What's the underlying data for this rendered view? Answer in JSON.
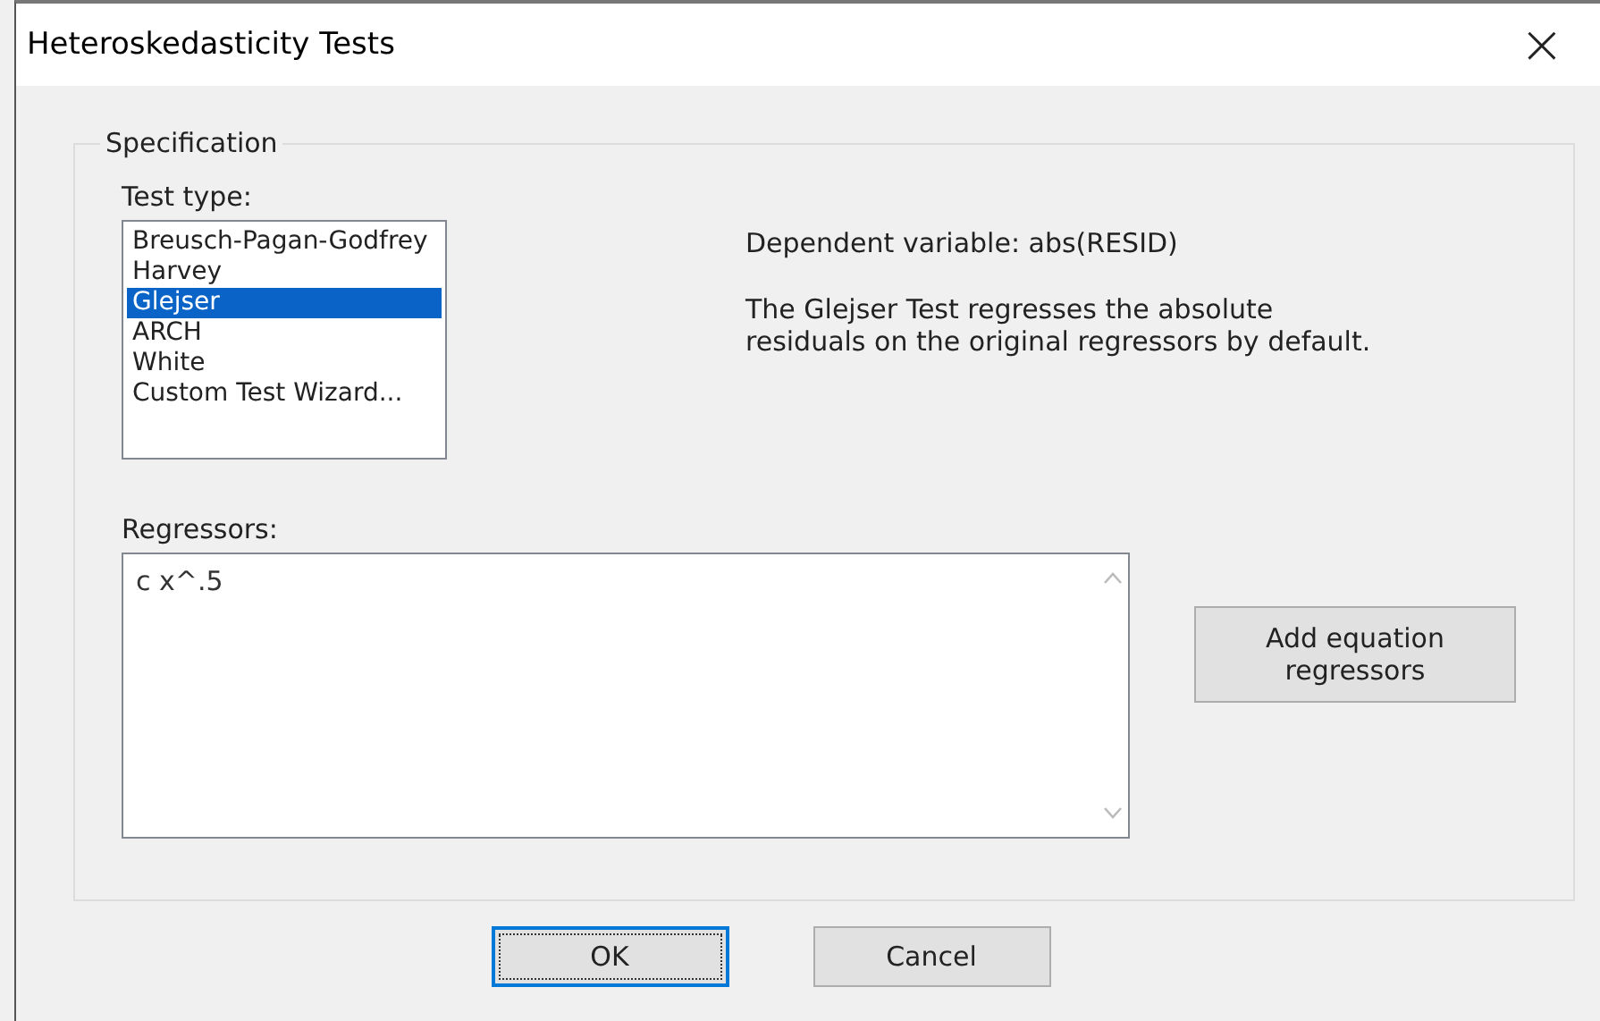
{
  "window": {
    "title": "Heteroskedasticity Tests",
    "close": "×"
  },
  "group": {
    "title": "Specification"
  },
  "test_type": {
    "label": "Test type:",
    "items": [
      {
        "label": "Breusch-Pagan-Godfrey",
        "selected": false
      },
      {
        "label": "Harvey",
        "selected": false
      },
      {
        "label": "Glejser",
        "selected": true
      },
      {
        "label": "ARCH",
        "selected": false
      },
      {
        "label": "White",
        "selected": false
      },
      {
        "label": "Custom Test Wizard...",
        "selected": false
      }
    ]
  },
  "dependent_variable": "Dependent variable: abs(RESID)",
  "description": "The Glejser Test regresses the absolute residuals on the original regressors by default.",
  "regressors": {
    "label": "Regressors:",
    "value": "c x^.5"
  },
  "add_button": "Add equation regressors",
  "buttons": [
    "OK",
    "Cancel"
  ]
}
